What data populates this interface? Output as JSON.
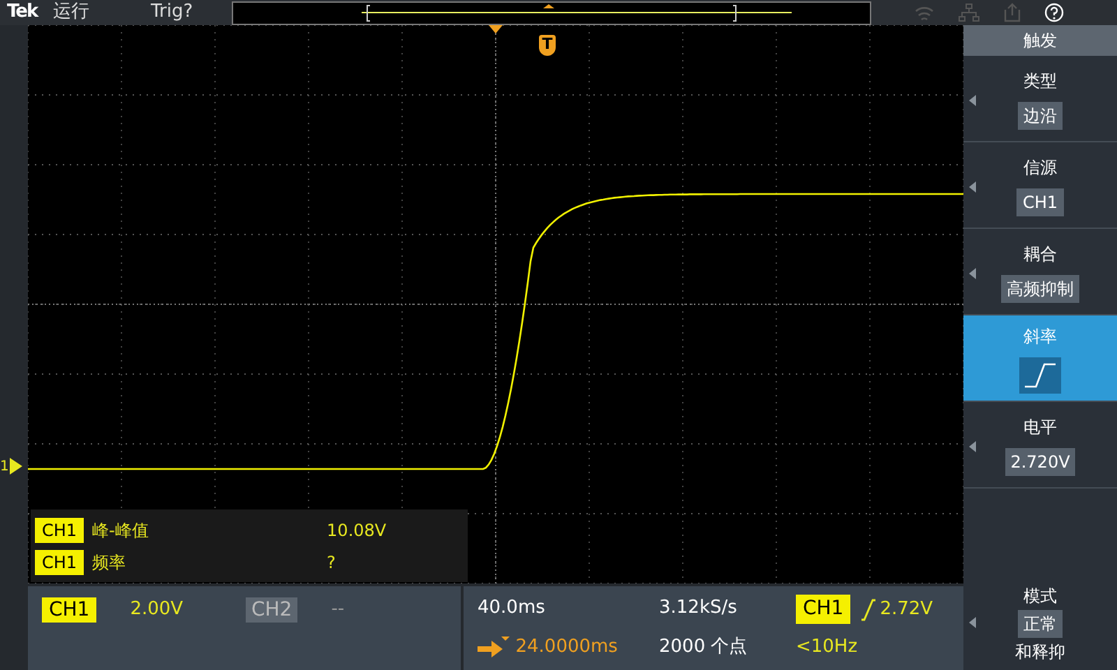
{
  "top_bar": {
    "logo": "Tek",
    "run_state": "运行",
    "trigger_state": "Trig?"
  },
  "trigger_marker": {
    "label": "T"
  },
  "channel_marker": {
    "label": "1"
  },
  "measurements": [
    {
      "source": "CH1",
      "name": "峰-峰值",
      "value": "10.08V"
    },
    {
      "source": "CH1",
      "name": "频率",
      "value": "?"
    }
  ],
  "channels": [
    {
      "name": "CH1",
      "scale": "2.00V",
      "on": true
    },
    {
      "name": "CH2",
      "scale": "--",
      "on": false
    }
  ],
  "horizontal": {
    "scale": "40.0ms",
    "position": "24.0000ms",
    "sample_rate": "3.12kS/s",
    "record_length": "2000 个点"
  },
  "trigger": {
    "source": "CH1",
    "level": "2.72V",
    "frequency": "<10Hz"
  },
  "menu": {
    "title": "触发",
    "items": [
      {
        "kind": "value",
        "label": "类型",
        "value": "边沿",
        "selected": false
      },
      {
        "kind": "value",
        "label": "信源",
        "value": "CH1",
        "selected": false
      },
      {
        "kind": "value",
        "label": "耦合",
        "value": "高频抑制",
        "selected": false
      },
      {
        "kind": "slope",
        "label": "斜率",
        "selected": true
      },
      {
        "kind": "value",
        "label": "电平",
        "value": "2.720V",
        "selected": false
      }
    ],
    "mode": {
      "label": "模式",
      "value": "正常",
      "suffix": "和释抑"
    }
  }
}
